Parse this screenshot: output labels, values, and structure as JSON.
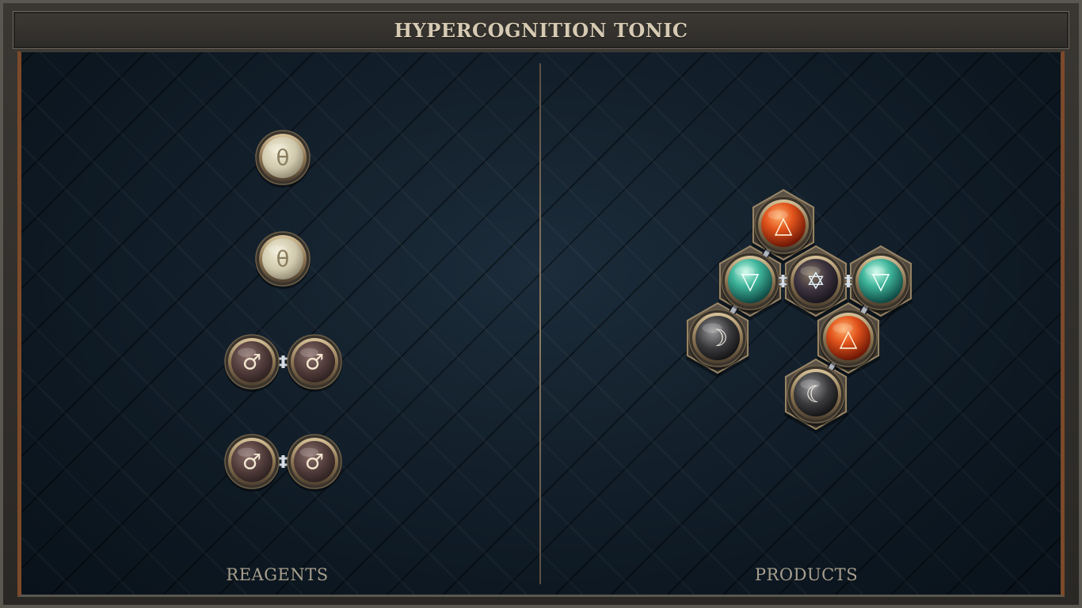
{
  "title": "HYPERCOGNITION TONIC",
  "panels": {
    "reagents_label": "REAGENTS",
    "products_label": "PRODUCTS"
  },
  "reagents": [
    {
      "atoms": [
        {
          "element": "salt",
          "symbol": "θ"
        }
      ]
    },
    {
      "atoms": [
        {
          "element": "salt",
          "symbol": "θ"
        }
      ]
    },
    {
      "atoms": [
        {
          "element": "iron",
          "symbol": "♂"
        },
        {
          "element": "iron",
          "symbol": "♂"
        }
      ],
      "bond": "double"
    },
    {
      "atoms": [
        {
          "element": "iron",
          "symbol": "♂"
        },
        {
          "element": "iron",
          "symbol": "♂"
        }
      ],
      "bond": "double"
    }
  ],
  "product": {
    "atoms": [
      {
        "element": "fire",
        "symbol": "△"
      },
      {
        "element": "water",
        "symbol": "▽"
      },
      {
        "element": "quintessence",
        "symbol": "✡"
      },
      {
        "element": "water",
        "symbol": "▽"
      },
      {
        "element": "silver",
        "symbol": "☽"
      },
      {
        "element": "fire",
        "symbol": "△"
      },
      {
        "element": "silver",
        "symbol": "☾"
      }
    ]
  },
  "colors": {
    "salt": "#d8d2b8",
    "iron": "#5c4644",
    "fire": "#e2541c",
    "water": "#3fb59b",
    "quintessence": "#4a3f46",
    "silver": "#3a3a3c",
    "rim": "#b8a27a",
    "board": "#0e1a24"
  }
}
